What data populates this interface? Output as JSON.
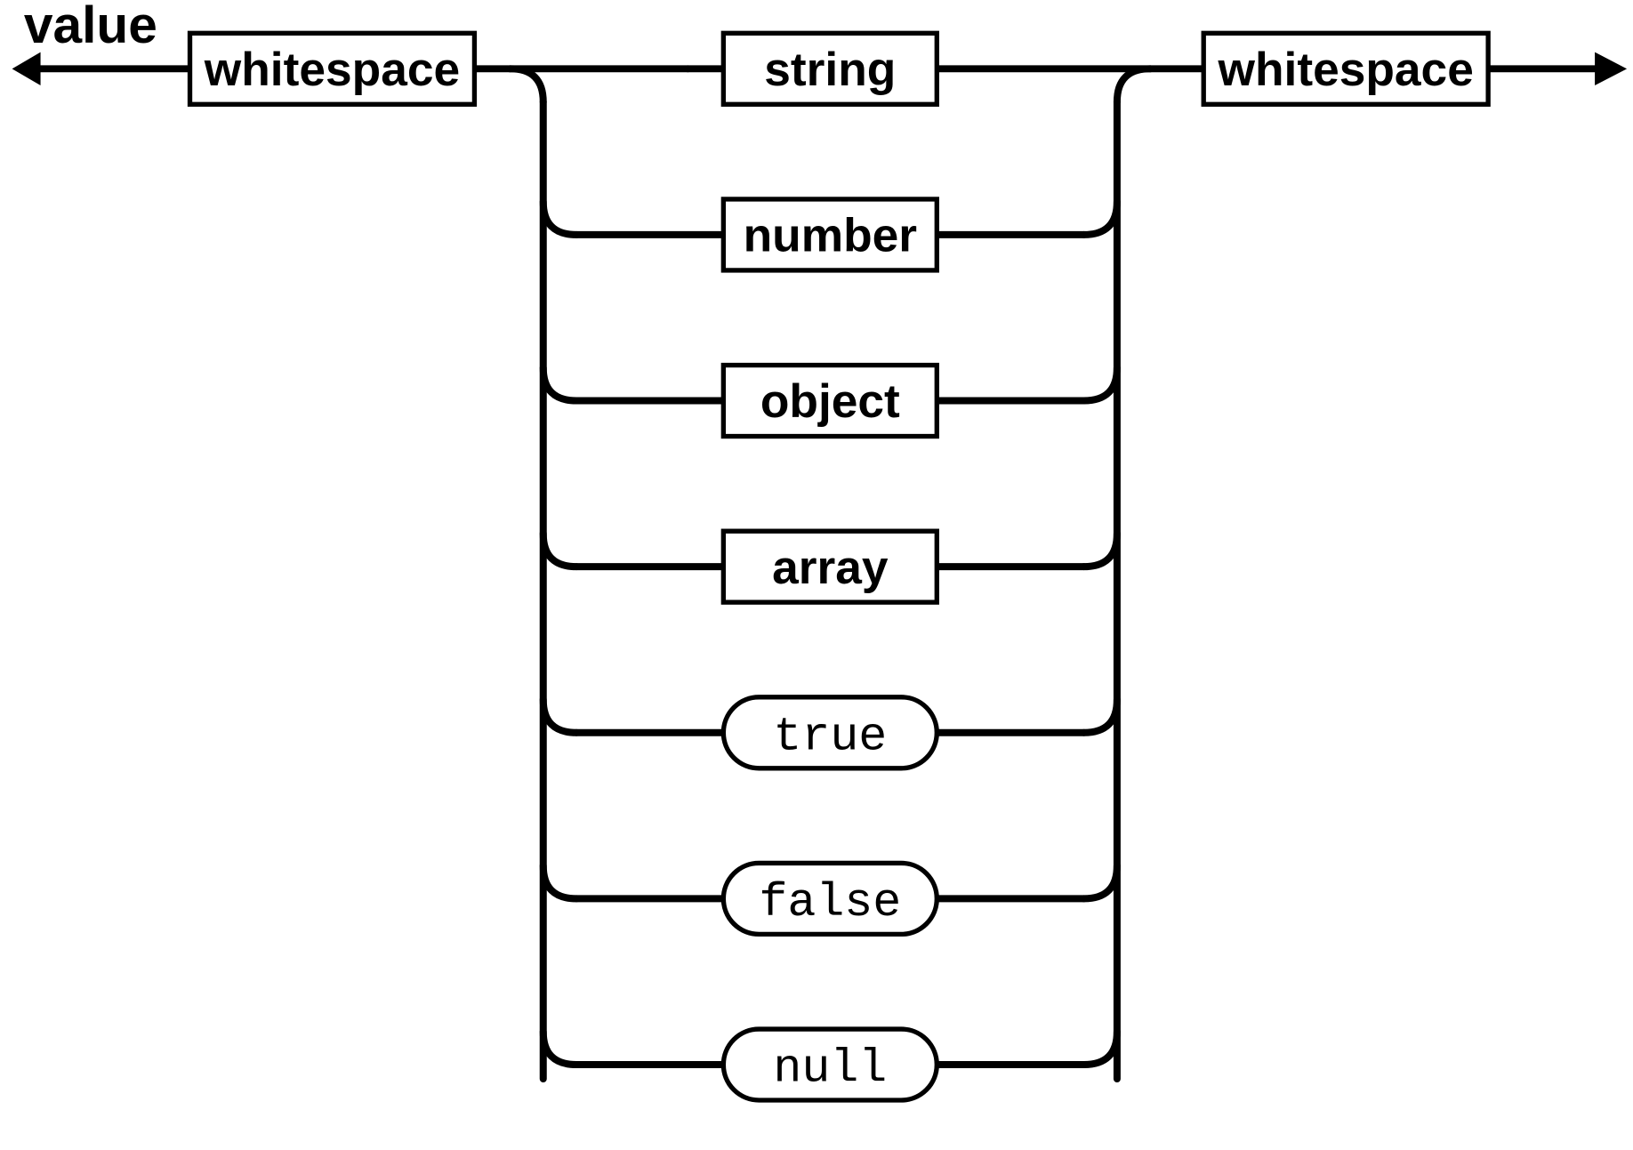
{
  "diagram": {
    "title": "value",
    "leading": {
      "label": "whitespace",
      "kind": "nonterminal"
    },
    "alternatives": [
      {
        "label": "string",
        "kind": "nonterminal"
      },
      {
        "label": "number",
        "kind": "nonterminal"
      },
      {
        "label": "object",
        "kind": "nonterminal"
      },
      {
        "label": "array",
        "kind": "nonterminal"
      },
      {
        "label": "true",
        "kind": "terminal"
      },
      {
        "label": "false",
        "kind": "terminal"
      },
      {
        "label": "null",
        "kind": "terminal"
      }
    ],
    "trailing": {
      "label": "whitespace",
      "kind": "nonterminal"
    }
  }
}
